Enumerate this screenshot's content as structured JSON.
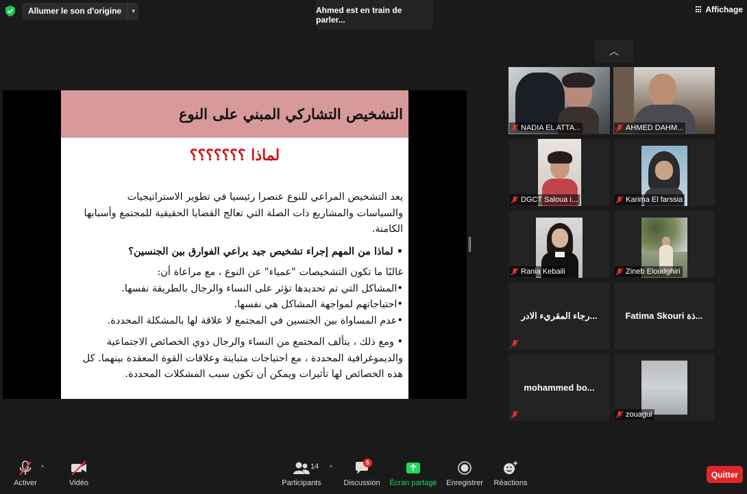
{
  "top": {
    "audio_label": "Allumer le son d'origine",
    "speaking_label": "Ahmed est en train de parler...",
    "view_label": "Affichage"
  },
  "slide": {
    "title": "التشخيص التشاركي المبني على النوع",
    "subtitle": "لماذا ؟؟؟؟؟؟؟",
    "para1": "يعد التشخيص المراعي للنوع عنصرا رئيسيا في تطوير الاستراتيجيات والسياسات والمشاريع ذات الصلة التي تعالج القضايا الحقيقية للمجتمع وأسبابها الكامنة.",
    "question": "• لماذا من المهم إجراء تشخيص جيد يراعي الفوارق بين الجنسين؟",
    "intro": "غالبًا ما تكون التشخيصات \"عمياء\" عن النوع ، مع مراعاة أن:",
    "b1": "•المشاكل التي تم تحديدها تؤثر على النساء والرجال بالطريقة نفسها.",
    "b2": "•احتياجاتهم لمواجهة المشاكل هي نفسها.",
    "b3": "•عدم المساواة بين الجنسين في المجتمع لا علاقة لها بالمشكلة المحددة.",
    "para2": "• ومع ذلك ، يتألف المجتمع من النساء والرجال ذوي الخصائص الاجتماعية والديموغرافية المحددة ، مع احتياجات متباينة وعلاقات القوة المعقدة بينهما. كل هذه الخصائص لها تأثيرات ويمكن أن تكون سبب المشكلات المحددة."
  },
  "participants": [
    {
      "name": "NADIA EL ATTA..."
    },
    {
      "name": "AHMED DAHM..."
    },
    {
      "name": "DGCT Saloua i..."
    },
    {
      "name": "Karima El farssia"
    },
    {
      "name": "Rania Kebaili"
    },
    {
      "name": "Zineb Eloudghiri"
    },
    {
      "name": "رجاء المقريء الادر..."
    },
    {
      "name": "Fatima  Skouri ذة..."
    },
    {
      "name": "mohammed  bo..."
    },
    {
      "name": "zouagui"
    }
  ],
  "toolbar": {
    "mute_label": "Activer",
    "video_label": "Vidéo",
    "participants_label": "Participants",
    "participants_count": "14",
    "chat_label": "Discussion",
    "chat_badge": "5",
    "share_label": "Écran partagé",
    "record_label": "Enregistrer",
    "reactions_label": "Réactions",
    "quit_label": "Quitter"
  },
  "colors": {
    "share_green": "#23d959",
    "quit_red": "#e0262b",
    "slide_header": "#d8999b",
    "subtitle_red": "#d01010"
  },
  "icons": [
    "shield-icon",
    "chevron-down-icon",
    "grid-icon",
    "chevron-up-icon",
    "mic-off-icon",
    "video-off-icon",
    "participants-icon",
    "chat-icon",
    "share-screen-icon",
    "record-icon",
    "reaction-icon"
  ]
}
